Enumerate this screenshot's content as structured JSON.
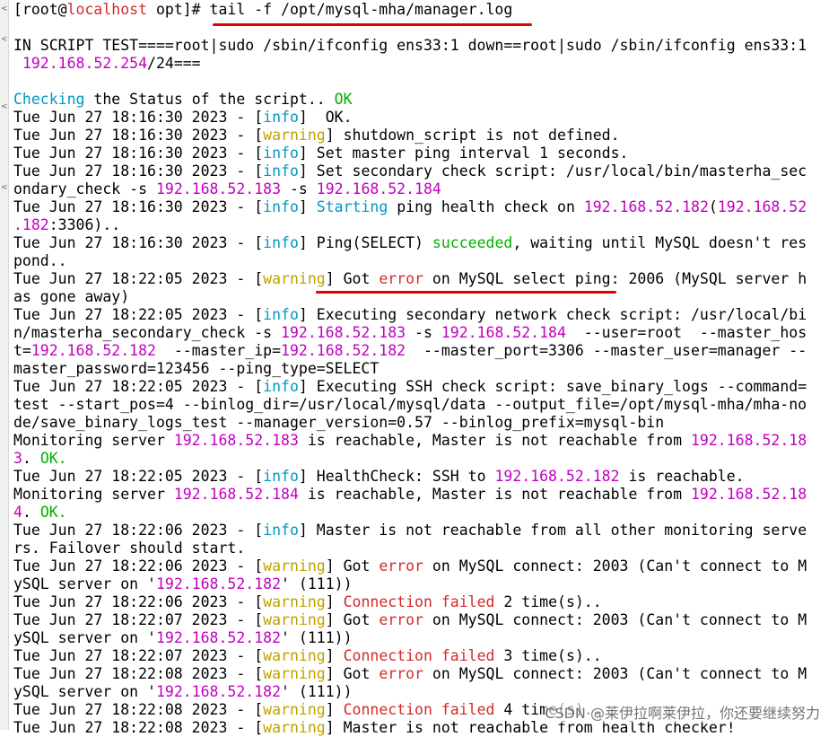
{
  "terminal": {
    "lines": [
      [
        {
          "t": "[root@"
        },
        {
          "t": "localhost",
          "c": "host"
        },
        {
          "t": " opt]# tail -f /opt/mysql-mha/manager.log"
        }
      ],
      [],
      [
        {
          "t": "IN SCRIPT TEST====root|sudo /sbin/ifconfig ens33:1 down==root|sudo /sbin/ifconfig ens33:1"
        }
      ],
      [
        {
          "t": " "
        },
        {
          "t": "192.168.52.254",
          "c": "ip"
        },
        {
          "t": "/24==="
        }
      ],
      [],
      [
        {
          "t": "Checking",
          "c": "kw"
        },
        {
          "t": " the Status of the script.. "
        },
        {
          "t": "OK",
          "c": "ok"
        }
      ],
      [
        {
          "t": "Tue Jun 27 18:16:30 2023 - ["
        },
        {
          "t": "info",
          "c": "kw"
        },
        {
          "t": "]  OK."
        }
      ],
      [
        {
          "t": "Tue Jun 27 18:16:30 2023 - ["
        },
        {
          "t": "warning",
          "c": "warn"
        },
        {
          "t": "] shutdown_script is not defined."
        }
      ],
      [
        {
          "t": "Tue Jun 27 18:16:30 2023 - ["
        },
        {
          "t": "info",
          "c": "kw"
        },
        {
          "t": "] Set master ping interval 1 seconds."
        }
      ],
      [
        {
          "t": "Tue Jun 27 18:16:30 2023 - ["
        },
        {
          "t": "info",
          "c": "kw"
        },
        {
          "t": "] Set secondary check script: /usr/local/bin/masterha_sec"
        }
      ],
      [
        {
          "t": "ondary_check -s "
        },
        {
          "t": "192.168.52.183",
          "c": "ip"
        },
        {
          "t": " -s "
        },
        {
          "t": "192.168.52.184",
          "c": "ip"
        }
      ],
      [
        {
          "t": "Tue Jun 27 18:16:30 2023 - ["
        },
        {
          "t": "info",
          "c": "kw"
        },
        {
          "t": "] "
        },
        {
          "t": "Starting",
          "c": "kw"
        },
        {
          "t": " ping health check on "
        },
        {
          "t": "192.168.52.182",
          "c": "ip"
        },
        {
          "t": "("
        },
        {
          "t": "192.168.52",
          "c": "ip"
        }
      ],
      [
        {
          "t": ".182",
          "c": "ip"
        },
        {
          "t": ":3306).."
        }
      ],
      [
        {
          "t": "Tue Jun 27 18:16:30 2023 - ["
        },
        {
          "t": "info",
          "c": "kw"
        },
        {
          "t": "] Ping(SELECT) "
        },
        {
          "t": "succeeded",
          "c": "ok"
        },
        {
          "t": ", waiting until MySQL doesn't res"
        }
      ],
      [
        {
          "t": "pond.."
        }
      ],
      [
        {
          "t": "Tue Jun 27 18:22:05 2023 - ["
        },
        {
          "t": "warning",
          "c": "warn"
        },
        {
          "t": "] Got "
        },
        {
          "t": "error",
          "c": "err"
        },
        {
          "t": " on MySQL select ping: 2006 (MySQL server h"
        }
      ],
      [
        {
          "t": "as gone away)"
        }
      ],
      [
        {
          "t": "Tue Jun 27 18:22:05 2023 - ["
        },
        {
          "t": "info",
          "c": "kw"
        },
        {
          "t": "] Executing secondary network check script: /usr/local/bi"
        }
      ],
      [
        {
          "t": "n/masterha_secondary_check -s "
        },
        {
          "t": "192.168.52.183",
          "c": "ip"
        },
        {
          "t": " -s "
        },
        {
          "t": "192.168.52.184",
          "c": "ip"
        },
        {
          "t": "  --user=root  --master_hos"
        }
      ],
      [
        {
          "t": "t="
        },
        {
          "t": "192.168.52.182",
          "c": "ip"
        },
        {
          "t": "  --master_ip="
        },
        {
          "t": "192.168.52.182",
          "c": "ip"
        },
        {
          "t": "  --master_port=3306 --master_user=manager --"
        }
      ],
      [
        {
          "t": "master_password=123456 --ping_type=SELECT"
        }
      ],
      [
        {
          "t": "Tue Jun 27 18:22:05 2023 - ["
        },
        {
          "t": "info",
          "c": "kw"
        },
        {
          "t": "] Executing SSH check script: save_binary_logs --command="
        }
      ],
      [
        {
          "t": "test --start_pos=4 --binlog_dir=/usr/local/mysql/data --output_file=/opt/mysql-mha/mha-no"
        }
      ],
      [
        {
          "t": "de/save_binary_logs_test --manager_version=0.57 --binlog_prefix=mysql-bin"
        }
      ],
      [
        {
          "t": "Monitoring server "
        },
        {
          "t": "192.168.52.183",
          "c": "ip"
        },
        {
          "t": " is reachable, Master is not reachable from "
        },
        {
          "t": "192.168.52.18",
          "c": "ip"
        }
      ],
      [
        {
          "t": "3",
          "c": "ip"
        },
        {
          "t": ". "
        },
        {
          "t": "OK.",
          "c": "ok"
        }
      ],
      [
        {
          "t": "Tue Jun 27 18:22:05 2023 - ["
        },
        {
          "t": "info",
          "c": "kw"
        },
        {
          "t": "] HealthCheck: SSH to "
        },
        {
          "t": "192.168.52.182",
          "c": "ip"
        },
        {
          "t": " is reachable."
        }
      ],
      [
        {
          "t": "Monitoring server "
        },
        {
          "t": "192.168.52.184",
          "c": "ip"
        },
        {
          "t": " is reachable, Master is not reachable from "
        },
        {
          "t": "192.168.52.18",
          "c": "ip"
        }
      ],
      [
        {
          "t": "4",
          "c": "ip"
        },
        {
          "t": ". "
        },
        {
          "t": "OK.",
          "c": "ok"
        }
      ],
      [
        {
          "t": "Tue Jun 27 18:22:06 2023 - ["
        },
        {
          "t": "info",
          "c": "kw"
        },
        {
          "t": "] Master is not reachable from all other monitoring serve"
        }
      ],
      [
        {
          "t": "rs. Failover should start."
        }
      ],
      [
        {
          "t": "Tue Jun 27 18:22:06 2023 - ["
        },
        {
          "t": "warning",
          "c": "warn"
        },
        {
          "t": "] Got "
        },
        {
          "t": "error",
          "c": "err"
        },
        {
          "t": " on MySQL connect: 2003 (Can't connect to M"
        }
      ],
      [
        {
          "t": "ySQL server on '"
        },
        {
          "t": "192.168.52.182",
          "c": "ip"
        },
        {
          "t": "' (111))"
        }
      ],
      [
        {
          "t": "Tue Jun 27 18:22:06 2023 - ["
        },
        {
          "t": "warning",
          "c": "warn"
        },
        {
          "t": "] "
        },
        {
          "t": "Connection failed",
          "c": "err"
        },
        {
          "t": " 2 time(s).."
        }
      ],
      [
        {
          "t": "Tue Jun 27 18:22:07 2023 - ["
        },
        {
          "t": "warning",
          "c": "warn"
        },
        {
          "t": "] Got "
        },
        {
          "t": "error",
          "c": "err"
        },
        {
          "t": " on MySQL connect: 2003 (Can't connect to M"
        }
      ],
      [
        {
          "t": "ySQL server on '"
        },
        {
          "t": "192.168.52.182",
          "c": "ip"
        },
        {
          "t": "' (111))"
        }
      ],
      [
        {
          "t": "Tue Jun 27 18:22:07 2023 - ["
        },
        {
          "t": "warning",
          "c": "warn"
        },
        {
          "t": "] "
        },
        {
          "t": "Connection failed",
          "c": "err"
        },
        {
          "t": " 3 time(s).."
        }
      ],
      [
        {
          "t": "Tue Jun 27 18:22:08 2023 - ["
        },
        {
          "t": "warning",
          "c": "warn"
        },
        {
          "t": "] Got "
        },
        {
          "t": "error",
          "c": "err"
        },
        {
          "t": " on MySQL connect: 2003 (Can't connect to M"
        }
      ],
      [
        {
          "t": "ySQL server on '"
        },
        {
          "t": "192.168.52.182",
          "c": "ip"
        },
        {
          "t": "' (111))"
        }
      ],
      [
        {
          "t": "Tue Jun 27 18:22:08 2023 - ["
        },
        {
          "t": "warning",
          "c": "warn"
        },
        {
          "t": "] "
        },
        {
          "t": "Connection failed",
          "c": "err"
        },
        {
          "t": " 4 time(s).."
        }
      ],
      [
        {
          "t": "Tue Jun 27 18:22:08 2023 - ["
        },
        {
          "t": "warning",
          "c": "warn"
        },
        {
          "t": "] Master is not reachable from health checker!"
        }
      ]
    ]
  },
  "gutter_marks": [
    "<",
    "<",
    "<",
    "<"
  ],
  "watermark": "CSDN @莱伊拉啊莱伊拉，你还要继续努力",
  "colors": {
    "ip": "#c000c0",
    "keyword": "#0097c4",
    "ok": "#00b000",
    "warning": "#c0a000",
    "error": "#d42a2a",
    "underline": "#e00000"
  }
}
